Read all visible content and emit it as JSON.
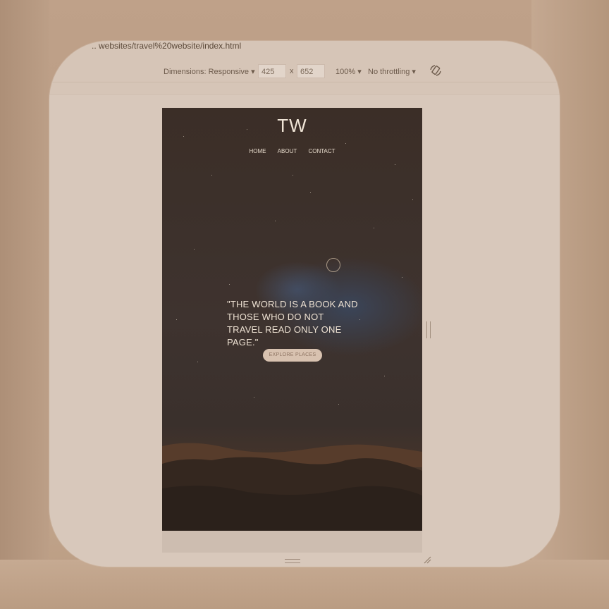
{
  "browser": {
    "url": "websites/travel%20website/index.html"
  },
  "devtools": {
    "dimensions_label": "Dimensions: Responsive",
    "width_value": "425",
    "times": "x",
    "height_value": "652",
    "zoom": "100%",
    "throttling": "No throttling"
  },
  "site": {
    "logo": "TW",
    "nav": [
      "HOME",
      "ABOUT",
      "CONTACT"
    ],
    "quote": "\"THE WORLD IS A BOOK AND THOSE WHO DO NOT TRAVEL READ ONLY ONE PAGE.\"",
    "cta_label": "EXPLORE PLACES"
  },
  "colors": {
    "sky": "#3b2e27",
    "cta_bg": "#d8c2b0",
    "card_bg": "#d6c5b7"
  }
}
